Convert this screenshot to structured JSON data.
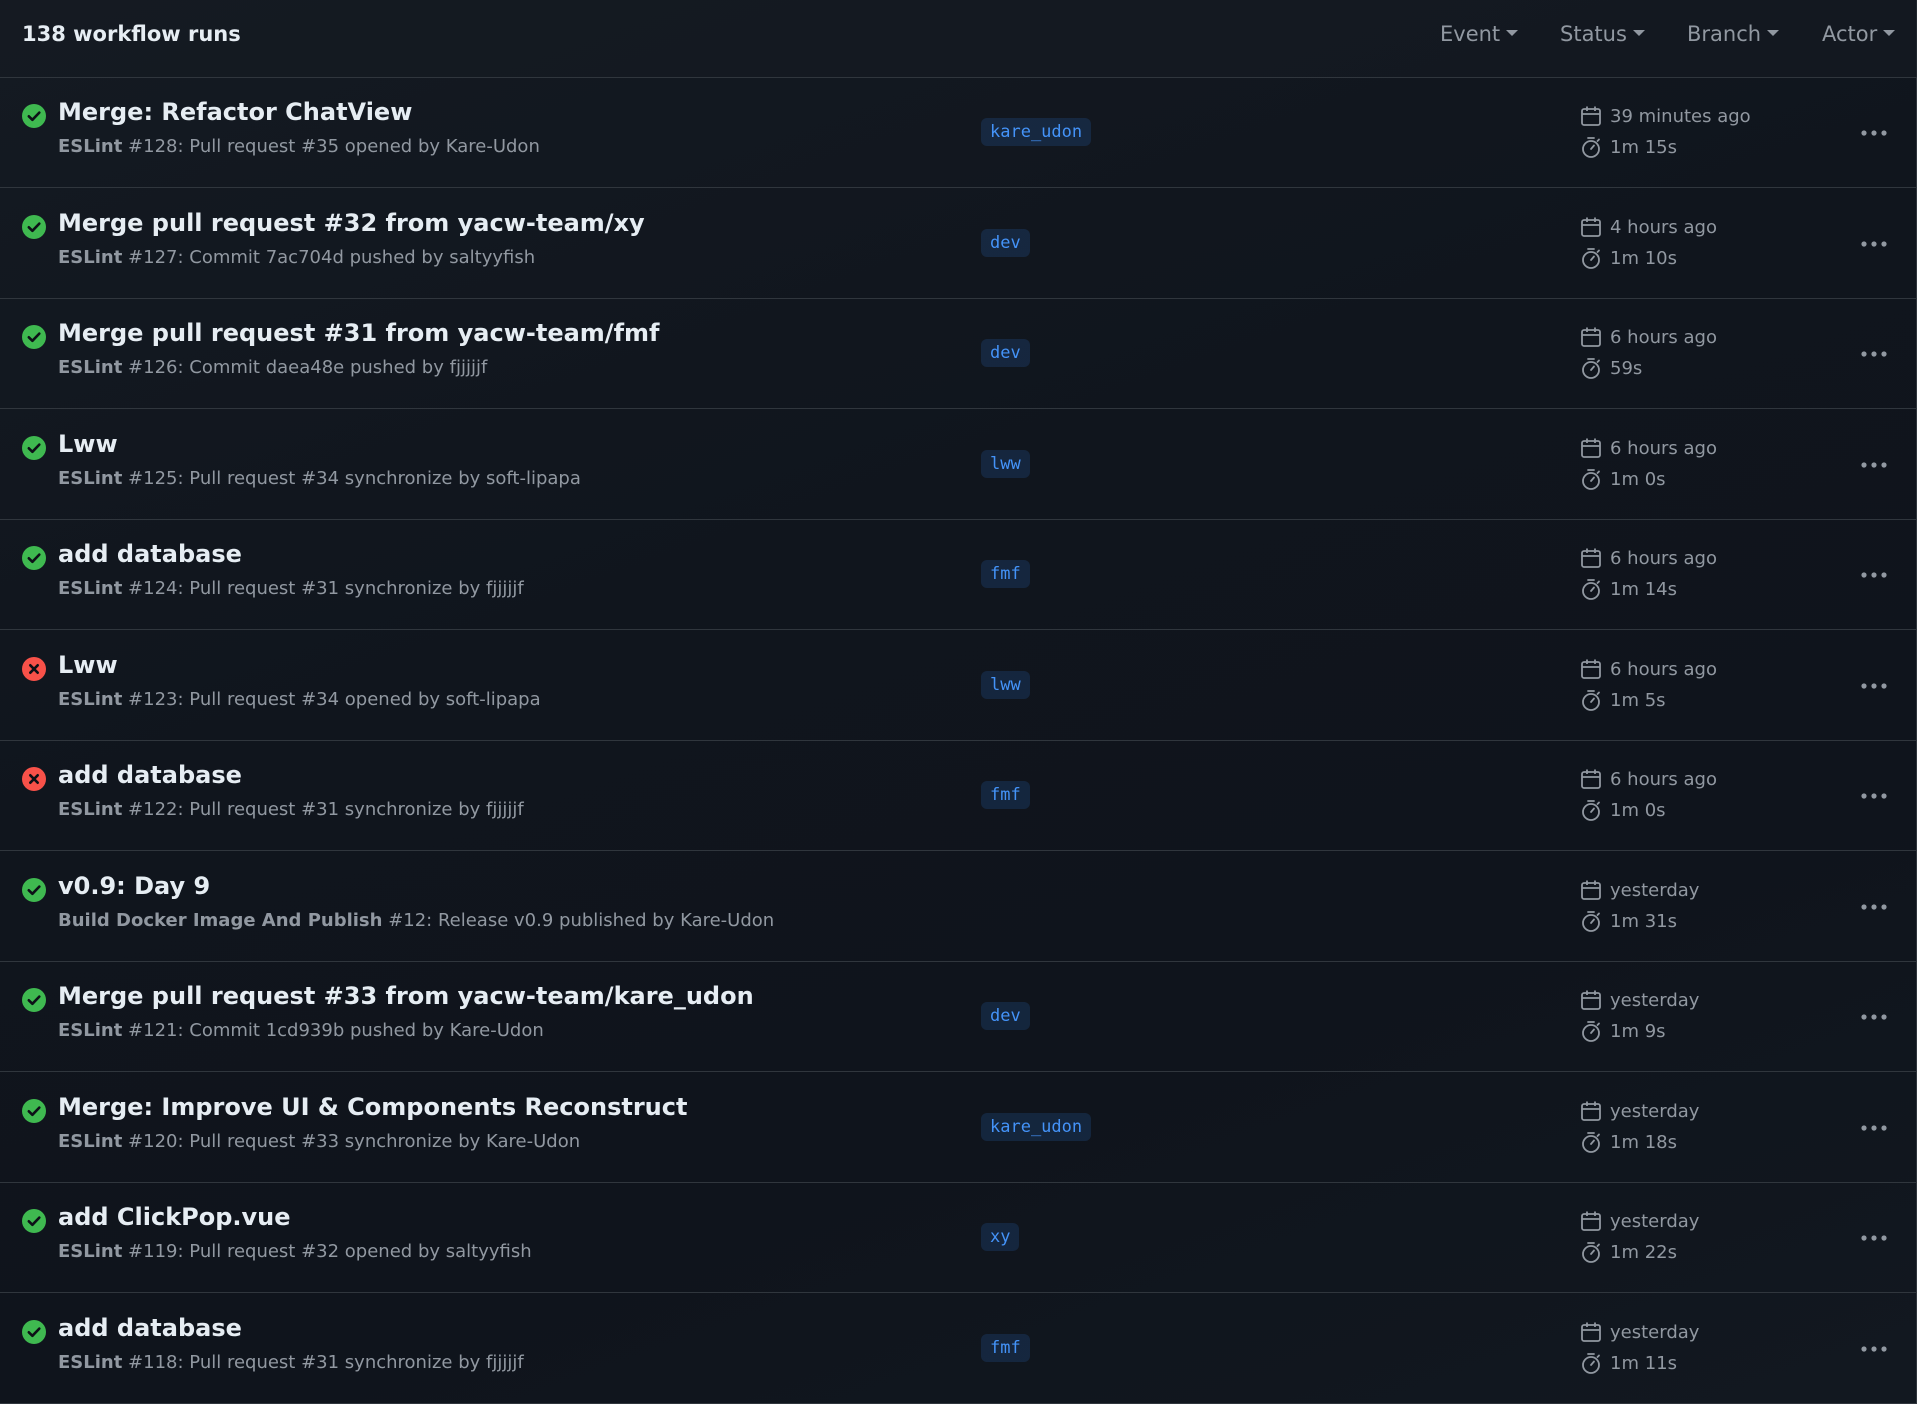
{
  "header": {
    "title": "138 workflow runs",
    "filters": [
      {
        "label": "Event"
      },
      {
        "label": "Status"
      },
      {
        "label": "Branch"
      },
      {
        "label": "Actor"
      }
    ]
  },
  "colors": {
    "success": "#3fb950",
    "failure": "#f85149",
    "branch_text": "#4493f8"
  },
  "runs": [
    {
      "status": "success",
      "title": "Merge: Refactor ChatView",
      "workflow": "ESLint",
      "detail": " #128: Pull request #35 opened by Kare-Udon",
      "branch": "kare_udon",
      "when": "39 minutes ago",
      "duration": "1m 15s"
    },
    {
      "status": "success",
      "title": "Merge pull request #32 from yacw-team/xy",
      "workflow": "ESLint",
      "detail": " #127: Commit 7ac704d pushed by saltyyfish",
      "branch": "dev",
      "when": "4 hours ago",
      "duration": "1m 10s"
    },
    {
      "status": "success",
      "title": "Merge pull request #31 from yacw-team/fmf",
      "workflow": "ESLint",
      "detail": " #126: Commit daea48e pushed by fjjjjjf",
      "branch": "dev",
      "when": "6 hours ago",
      "duration": "59s"
    },
    {
      "status": "success",
      "title": "Lww",
      "workflow": "ESLint",
      "detail": " #125: Pull request #34 synchronize by soft-lipapa",
      "branch": "lww",
      "when": "6 hours ago",
      "duration": "1m 0s"
    },
    {
      "status": "success",
      "title": "add database",
      "workflow": "ESLint",
      "detail": " #124: Pull request #31 synchronize by fjjjjjf",
      "branch": "fmf",
      "when": "6 hours ago",
      "duration": "1m 14s"
    },
    {
      "status": "failure",
      "title": "Lww",
      "workflow": "ESLint",
      "detail": " #123: Pull request #34 opened by soft-lipapa",
      "branch": "lww",
      "when": "6 hours ago",
      "duration": "1m 5s"
    },
    {
      "status": "failure",
      "title": "add database",
      "workflow": "ESLint",
      "detail": " #122: Pull request #31 synchronize by fjjjjjf",
      "branch": "fmf",
      "when": "6 hours ago",
      "duration": "1m 0s"
    },
    {
      "status": "success",
      "title": "v0.9: Day 9",
      "workflow": "Build Docker Image And Publish",
      "detail": " #12: Release v0.9 published by Kare-Udon",
      "branch": "",
      "when": "yesterday",
      "duration": "1m 31s"
    },
    {
      "status": "success",
      "title": "Merge pull request #33 from yacw-team/kare_udon",
      "workflow": "ESLint",
      "detail": " #121: Commit 1cd939b pushed by Kare-Udon",
      "branch": "dev",
      "when": "yesterday",
      "duration": "1m 9s"
    },
    {
      "status": "success",
      "title": "Merge: Improve UI & Components Reconstruct",
      "workflow": "ESLint",
      "detail": " #120: Pull request #33 synchronize by Kare-Udon",
      "branch": "kare_udon",
      "when": "yesterday",
      "duration": "1m 18s"
    },
    {
      "status": "success",
      "title": "add ClickPop.vue",
      "workflow": "ESLint",
      "detail": " #119: Pull request #32 opened by saltyyfish",
      "branch": "xy",
      "when": "yesterday",
      "duration": "1m 22s"
    },
    {
      "status": "success",
      "title": "add database",
      "workflow": "ESLint",
      "detail": " #118: Pull request #31 synchronize by fjjjjjf",
      "branch": "fmf",
      "when": "yesterday",
      "duration": "1m 11s"
    }
  ]
}
